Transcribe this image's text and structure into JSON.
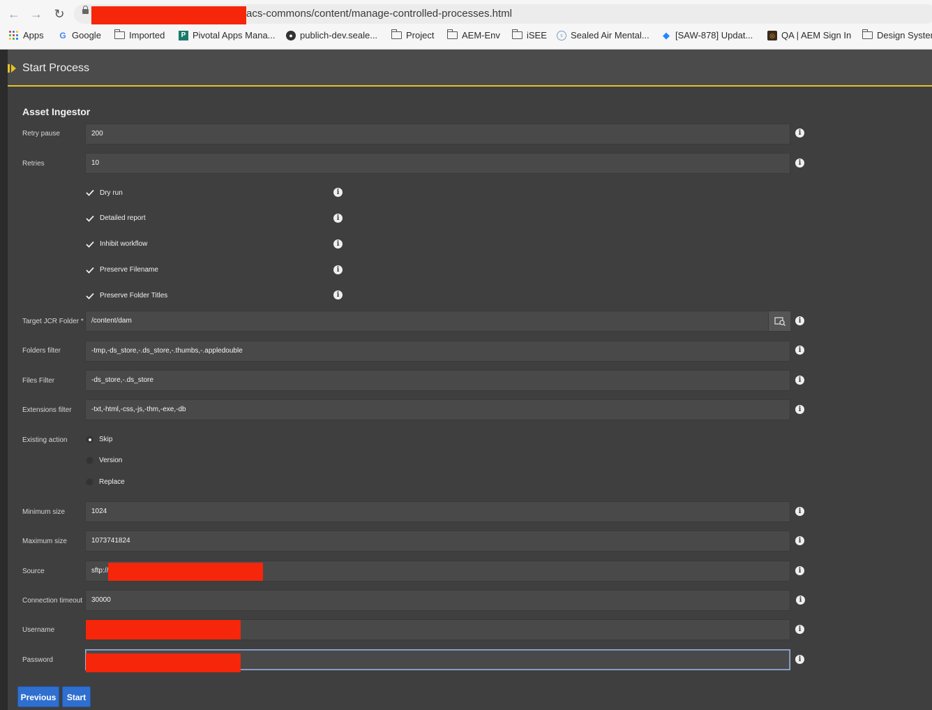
{
  "browser": {
    "url_visible": "acs-commons/content/manage-controlled-processes.html",
    "bookmarks": [
      {
        "label": "Apps",
        "icon": "apps-grid-icon"
      },
      {
        "label": "Google",
        "icon": "google-icon"
      },
      {
        "label": "Imported",
        "icon": "folder-icon"
      },
      {
        "label": "Pivotal Apps Mana...",
        "icon": "pivotal-icon"
      },
      {
        "label": "publich-dev.seale...",
        "icon": "globe-icon"
      },
      {
        "label": "Project",
        "icon": "folder-icon"
      },
      {
        "label": "AEM-Env",
        "icon": "folder-icon"
      },
      {
        "label": "iSEE",
        "icon": "folder-icon"
      },
      {
        "label": "Sealed Air Mental...",
        "icon": "site-icon"
      },
      {
        "label": "[SAW-878] Updat...",
        "icon": "jira-icon"
      },
      {
        "label": "QA | AEM Sign In",
        "icon": "aem-icon"
      },
      {
        "label": "Design Syster",
        "icon": "folder-icon"
      }
    ]
  },
  "header": {
    "title": "Start Process"
  },
  "form": {
    "section_title": "Asset Ingestor",
    "retry_pause": {
      "label": "Retry pause",
      "value": "200"
    },
    "retries": {
      "label": "Retries",
      "value": "10"
    },
    "checkboxes": [
      {
        "label": "Dry run",
        "checked": true
      },
      {
        "label": "Detailed report",
        "checked": true
      },
      {
        "label": "Inhibit workflow",
        "checked": true
      },
      {
        "label": "Preserve Filename",
        "checked": true
      },
      {
        "label": "Preserve Folder Titles",
        "checked": true
      }
    ],
    "target_folder": {
      "label": "Target JCR Folder *",
      "value": "/content/dam"
    },
    "folders_filter": {
      "label": "Folders filter",
      "value": "-tmp,-ds_store,-.ds_store,-.thumbs,-.appledouble"
    },
    "files_filter": {
      "label": "Files Filter",
      "value": "-ds_store,-.ds_store"
    },
    "extensions_filter": {
      "label": "Extensions filter",
      "value": "-txt,-html,-css,-js,-thm,-exe,-db"
    },
    "existing_action": {
      "label": "Existing action",
      "options": [
        "Skip",
        "Version",
        "Replace"
      ],
      "selected": "Skip"
    },
    "minimum_size": {
      "label": "Minimum size",
      "value": "1024"
    },
    "maximum_size": {
      "label": "Maximum size",
      "value": "1073741824"
    },
    "source": {
      "label": "Source",
      "value": "sftp://"
    },
    "connection_timeout": {
      "label": "Connection timeout",
      "value": "30000"
    },
    "username": {
      "label": "Username",
      "value": ""
    },
    "password": {
      "label": "Password",
      "value": ""
    }
  },
  "buttons": {
    "previous": "Previous",
    "start": "Start"
  },
  "colors": {
    "accent": "#e6c227",
    "primary_button": "#2f6fd0",
    "redaction": "#f5260a"
  }
}
